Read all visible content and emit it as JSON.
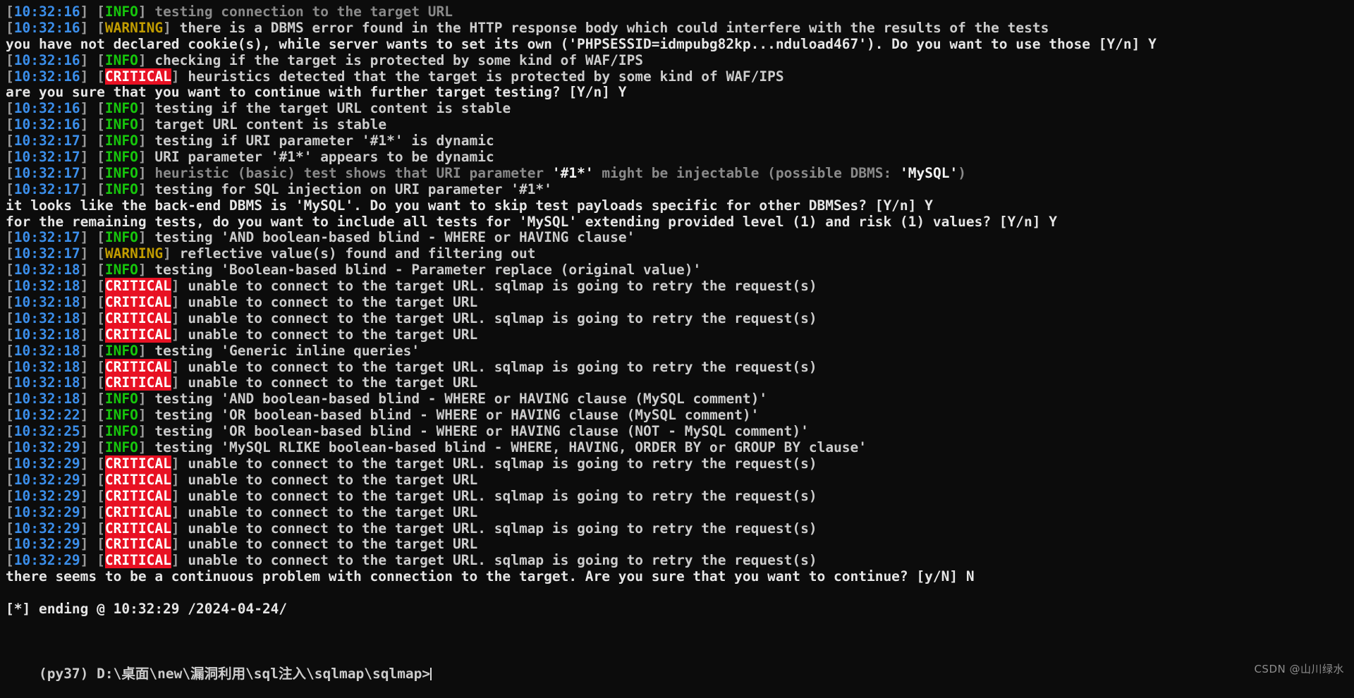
{
  "terminal": {
    "background": "#0c0c0c",
    "foreground": "#cccccc",
    "colors": {
      "timestamp": "#3b8eea",
      "bracket": "#9a9a9a",
      "info": "#16c60c",
      "warning": "#c19c00",
      "critical_bg": "#e81123",
      "critical_fg": "#ffffff",
      "dim_text": "#8a8a8a",
      "bright_text": "#f2f2f2",
      "watermark": "#8d8d8d"
    },
    "prompt": {
      "env": "(py37)",
      "path": "D:\\桌面\\new\\漏洞利用\\sql注入\\sqlmap\\sqlmap>",
      "full": "(py37) D:\\桌面\\new\\漏洞利用\\sql注入\\sqlmap\\sqlmap>",
      "cursor_visible": true
    },
    "watermark": "CSDN @山川绿水",
    "lines": [
      {
        "time": "[10:32:16]",
        "level": "INFO",
        "style": "dim",
        "text": "testing connection to the target URL"
      },
      {
        "time": "[10:32:16]",
        "level": "WARNING",
        "style": "normal",
        "text": "there is a DBMS error found in the HTTP response body which could interfere with the results of the tests"
      },
      {
        "level": "none",
        "style": "prompt",
        "text": "you have not declared cookie(s), while server wants to set its own ('PHPSESSID=idmpubg82kp...nduload467'). Do you want to use those [Y/n] Y"
      },
      {
        "time": "[10:32:16]",
        "level": "INFO",
        "style": "normal",
        "text": "checking if the target is protected by some kind of WAF/IPS"
      },
      {
        "time": "[10:32:16]",
        "level": "CRITICAL",
        "style": "normal",
        "text": "heuristics detected that the target is protected by some kind of WAF/IPS"
      },
      {
        "level": "none",
        "style": "prompt",
        "text": "are you sure that you want to continue with further target testing? [Y/n] Y"
      },
      {
        "time": "[10:32:16]",
        "level": "INFO",
        "style": "normal",
        "text": "testing if the target URL content is stable"
      },
      {
        "time": "[10:32:16]",
        "level": "INFO",
        "style": "normal",
        "text": "target URL content is stable"
      },
      {
        "time": "[10:32:17]",
        "level": "INFO",
        "style": "normal",
        "text": "testing if URI parameter '#1*' is dynamic"
      },
      {
        "time": "[10:32:17]",
        "level": "INFO",
        "style": "normal",
        "text": "URI parameter '#1*' appears to be dynamic"
      },
      {
        "time": "[10:32:17]",
        "level": "INFO",
        "style": "dim",
        "text": "heuristic (basic) test shows that URI parameter '#1*' might be injectable (possible DBMS: 'MySQL')",
        "emphasis": [
          "'#1*'",
          "'MySQL'"
        ]
      },
      {
        "time": "[10:32:17]",
        "level": "INFO",
        "style": "normal",
        "text": "testing for SQL injection on URI parameter '#1*'"
      },
      {
        "level": "none",
        "style": "prompt",
        "text": "it looks like the back-end DBMS is 'MySQL'. Do you want to skip test payloads specific for other DBMSes? [Y/n] Y"
      },
      {
        "level": "none",
        "style": "prompt",
        "text": "for the remaining tests, do you want to include all tests for 'MySQL' extending provided level (1) and risk (1) values? [Y/n] Y"
      },
      {
        "time": "[10:32:17]",
        "level": "INFO",
        "style": "normal",
        "text": "testing 'AND boolean-based blind - WHERE or HAVING clause'"
      },
      {
        "time": "[10:32:17]",
        "level": "WARNING",
        "style": "normal",
        "text": "reflective value(s) found and filtering out"
      },
      {
        "time": "[10:32:18]",
        "level": "INFO",
        "style": "normal",
        "text": "testing 'Boolean-based blind - Parameter replace (original value)'"
      },
      {
        "time": "[10:32:18]",
        "level": "CRITICAL",
        "style": "normal",
        "text": "unable to connect to the target URL. sqlmap is going to retry the request(s)"
      },
      {
        "time": "[10:32:18]",
        "level": "CRITICAL",
        "style": "normal",
        "text": "unable to connect to the target URL"
      },
      {
        "time": "[10:32:18]",
        "level": "CRITICAL",
        "style": "normal",
        "text": "unable to connect to the target URL. sqlmap is going to retry the request(s)"
      },
      {
        "time": "[10:32:18]",
        "level": "CRITICAL",
        "style": "normal",
        "text": "unable to connect to the target URL"
      },
      {
        "time": "[10:32:18]",
        "level": "INFO",
        "style": "normal",
        "text": "testing 'Generic inline queries'"
      },
      {
        "time": "[10:32:18]",
        "level": "CRITICAL",
        "style": "normal",
        "text": "unable to connect to the target URL. sqlmap is going to retry the request(s)"
      },
      {
        "time": "[10:32:18]",
        "level": "CRITICAL",
        "style": "normal",
        "text": "unable to connect to the target URL"
      },
      {
        "time": "[10:32:18]",
        "level": "INFO",
        "style": "normal",
        "text": "testing 'AND boolean-based blind - WHERE or HAVING clause (MySQL comment)'"
      },
      {
        "time": "[10:32:22]",
        "level": "INFO",
        "style": "normal",
        "text": "testing 'OR boolean-based blind - WHERE or HAVING clause (MySQL comment)'"
      },
      {
        "time": "[10:32:25]",
        "level": "INFO",
        "style": "normal",
        "text": "testing 'OR boolean-based blind - WHERE or HAVING clause (NOT - MySQL comment)'"
      },
      {
        "time": "[10:32:29]",
        "level": "INFO",
        "style": "normal",
        "text": "testing 'MySQL RLIKE boolean-based blind - WHERE, HAVING, ORDER BY or GROUP BY clause'"
      },
      {
        "time": "[10:32:29]",
        "level": "CRITICAL",
        "style": "normal",
        "text": "unable to connect to the target URL. sqlmap is going to retry the request(s)"
      },
      {
        "time": "[10:32:29]",
        "level": "CRITICAL",
        "style": "normal",
        "text": "unable to connect to the target URL"
      },
      {
        "time": "[10:32:29]",
        "level": "CRITICAL",
        "style": "normal",
        "text": "unable to connect to the target URL. sqlmap is going to retry the request(s)"
      },
      {
        "time": "[10:32:29]",
        "level": "CRITICAL",
        "style": "normal",
        "text": "unable to connect to the target URL"
      },
      {
        "time": "[10:32:29]",
        "level": "CRITICAL",
        "style": "normal",
        "text": "unable to connect to the target URL. sqlmap is going to retry the request(s)"
      },
      {
        "time": "[10:32:29]",
        "level": "CRITICAL",
        "style": "normal",
        "text": "unable to connect to the target URL"
      },
      {
        "time": "[10:32:29]",
        "level": "CRITICAL",
        "style": "normal",
        "text": "unable to connect to the target URL. sqlmap is going to retry the request(s)"
      },
      {
        "level": "none",
        "style": "prompt",
        "text": "there seems to be a continuous problem with connection to the target. Are you sure that you want to continue? [y/N] N"
      },
      {
        "level": "blank",
        "style": "blank",
        "text": ""
      },
      {
        "level": "none",
        "style": "plain",
        "text": "[*] ending @ 10:32:29 /2024-04-24/"
      },
      {
        "level": "blank",
        "style": "blank",
        "text": ""
      },
      {
        "level": "blank",
        "style": "blank",
        "text": ""
      }
    ]
  }
}
